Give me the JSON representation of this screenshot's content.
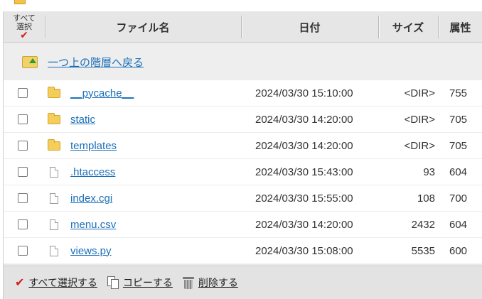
{
  "header": {
    "col_select_line1": "すべて",
    "col_select_line2": "選択",
    "col_name": "ファイル名",
    "col_date": "日付",
    "col_size": "サイズ",
    "col_attr": "属性"
  },
  "up": {
    "label": "一つ上の階層へ戻る"
  },
  "files": [
    {
      "name": "__pycache__",
      "type": "folder",
      "date": "2024/03/30 15:10:00",
      "size": "<DIR>",
      "attr": "755"
    },
    {
      "name": "static",
      "type": "folder",
      "date": "2024/03/30 14:20:00",
      "size": "<DIR>",
      "attr": "705"
    },
    {
      "name": "templates",
      "type": "folder",
      "date": "2024/03/30 14:20:00",
      "size": "<DIR>",
      "attr": "705"
    },
    {
      "name": ".htaccess",
      "type": "file",
      "date": "2024/03/30 15:43:00",
      "size": "93",
      "attr": "604"
    },
    {
      "name": "index.cgi",
      "type": "file",
      "date": "2024/03/30 15:55:00",
      "size": "108",
      "attr": "700"
    },
    {
      "name": "menu.csv",
      "type": "file",
      "date": "2024/03/30 14:20:00",
      "size": "2432",
      "attr": "604"
    },
    {
      "name": "views.py",
      "type": "file",
      "date": "2024/03/30 15:08:00",
      "size": "5535",
      "attr": "600"
    }
  ],
  "actions": {
    "select_all": "すべて選択する",
    "copy": "コピーする",
    "delete": "削除する"
  },
  "colors": {
    "link": "#1a6fb8",
    "check": "#d61d1d",
    "folder": "#f5cd5a"
  }
}
